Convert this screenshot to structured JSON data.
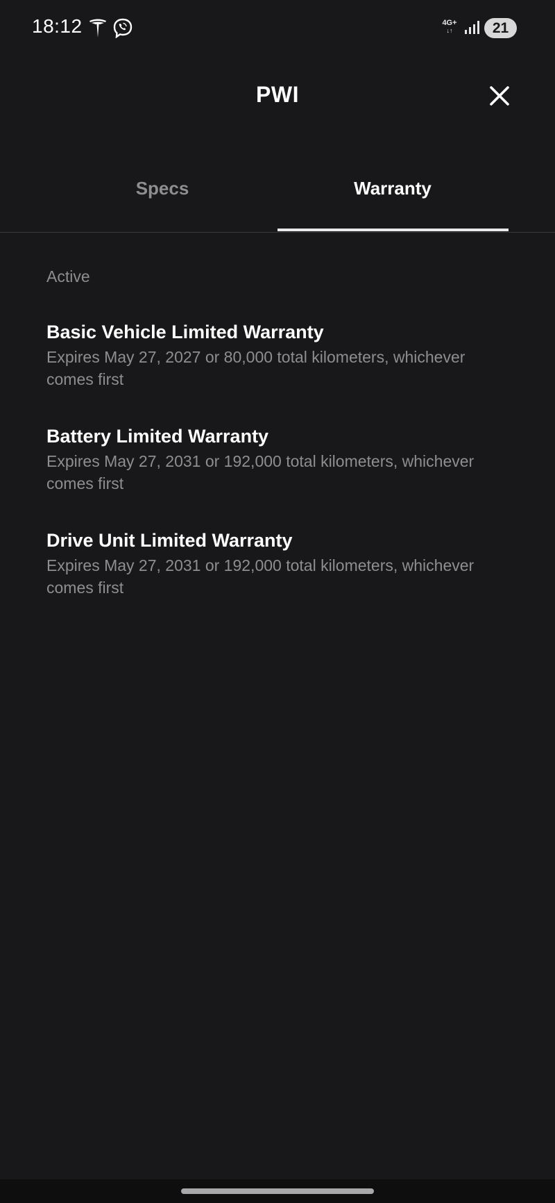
{
  "status_bar": {
    "time": "18:12",
    "network": "4G+",
    "network_arrows": "↓↑",
    "battery": "21",
    "icons": [
      "tesla-icon",
      "viber-icon",
      "signal-icon"
    ]
  },
  "header": {
    "title": "PWI",
    "close_icon": "close-icon"
  },
  "tabs": [
    {
      "label": "Specs",
      "active": false
    },
    {
      "label": "Warranty",
      "active": true
    }
  ],
  "warranty": {
    "section_label": "Active",
    "items": [
      {
        "title": "Basic Vehicle Limited Warranty",
        "description": "Expires May 27, 2027 or 80,000 total kilometers, whichever comes first"
      },
      {
        "title": "Battery Limited Warranty",
        "description": "Expires May 27, 2031 or 192,000 total kilometers, whichever comes first"
      },
      {
        "title": "Drive Unit Limited Warranty",
        "description": "Expires May 27, 2031 or 192,000 total kilometers, whichever comes first"
      }
    ]
  },
  "colors": {
    "background": "#18181a",
    "text_primary": "#ffffff",
    "text_secondary": "#8e8e90",
    "tab_indicator": "#e8e8e8"
  }
}
